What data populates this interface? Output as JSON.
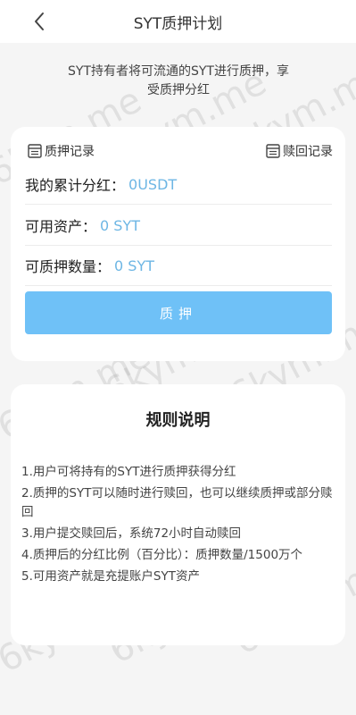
{
  "header": {
    "title": "SYT质押计划"
  },
  "intro": "SYT持有者将可流通的SYT进行质押，享受质押分红",
  "links": {
    "pledge_records": "质押记录",
    "redeem_records": "赎回记录"
  },
  "rows": [
    {
      "label": "我的累计分红：",
      "value": "0USDT"
    },
    {
      "label": "可用资产：",
      "value": "0 SYT"
    },
    {
      "label": "可质押数量：",
      "value": "0 SYT"
    }
  ],
  "button": {
    "label": "质押"
  },
  "rules": {
    "title": "规则说明",
    "items": [
      "1.用户可将持有的SYT进行质押获得分红",
      "2.质押的SYT可以随时进行赎回，也可以继续质押或部分赎回",
      "3.用户提交赎回后，系统72小时自动赎回",
      "4.质押后的分红比例（百分比）：质押数量/1500万个",
      "5.可用资产就是充提账户SYT资产"
    ]
  },
  "watermark": "6kym.me",
  "colors": {
    "accent_button": "#6fc1f7",
    "value_text": "#6db6e4"
  }
}
